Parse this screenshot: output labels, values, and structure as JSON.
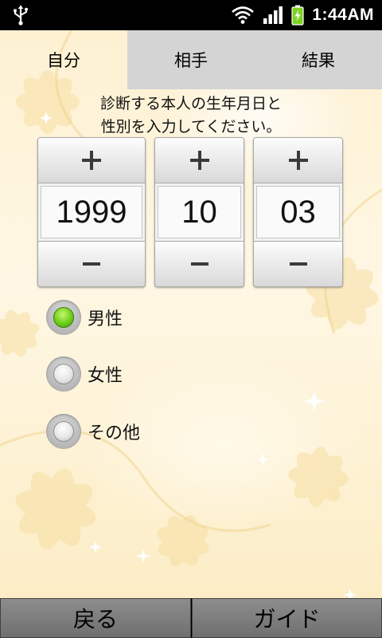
{
  "status_bar": {
    "time": "1:44AM",
    "icons": [
      "usb-icon",
      "wifi-icon",
      "signal-icon",
      "battery-charging-icon"
    ]
  },
  "tabs": [
    {
      "label": "自分",
      "active": true
    },
    {
      "label": "相手",
      "active": false
    },
    {
      "label": "結果",
      "active": false
    }
  ],
  "instruction": {
    "line1": "診断する本人の生年月日と",
    "line2": "性別を入力してください。"
  },
  "birthdate": {
    "year": "1999",
    "month": "10",
    "day": "03",
    "increment_icon": "plus-icon",
    "decrement_icon": "minus-icon"
  },
  "gender": {
    "options": [
      {
        "label": "男性",
        "checked": true
      },
      {
        "label": "女性",
        "checked": false
      },
      {
        "label": "その他",
        "checked": false
      }
    ],
    "checked_color": "#6bcf18"
  },
  "footer": {
    "back_label": "戻る",
    "guide_label": "ガイド"
  },
  "colors": {
    "background": "#fdf3d6",
    "inactive_tab": "#d4d4d4",
    "footer_button": "#7a7a7a"
  }
}
